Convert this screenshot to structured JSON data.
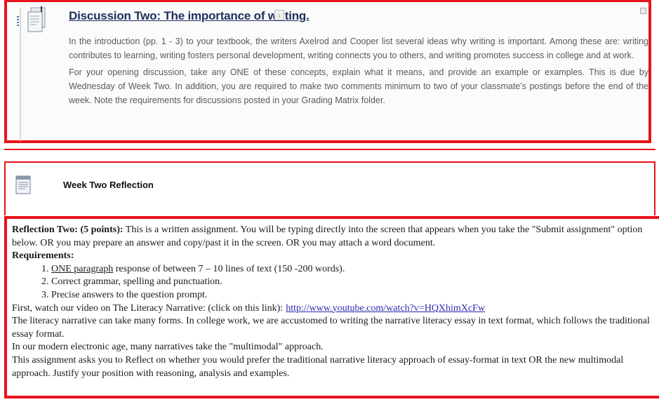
{
  "discussion": {
    "title": "Discussion Two: The importance of writing.",
    "menu_icon": "chevron-down-icon",
    "paragraph1": "In the introduction (pp. 1 - 3) to your textbook, the writers Axelrod and Cooper list several ideas why writing is important. Among these are: writing contributes to learning, writing fosters personal development, writing connects you to others, and writing promotes success in college and at work.",
    "paragraph2": "For your opening discussion, take any ONE of these concepts, explain what it means, and provide an example or examples. This is due by Wednesday of Week Two. In addition, you are required to make two comments minimum to two of your classmate's postings before the end of the week. Note the requirements for discussions posted in your Grading Matrix folder."
  },
  "week_item": {
    "title": "Week Two Reflection",
    "icon": "document-icon"
  },
  "reflection": {
    "heading": "Reflection Two: (5 points):",
    "intro": " This is a written assignment. You will be typing directly into the screen that appears when you take the \"Submit assignment\" option below. OR you may prepare an answer and copy/past it in the screen. OR you may attach a word document.",
    "requirements_label": "Requirements:",
    "req1_underlined": "ONE paragraph",
    "req1_rest": " response of between 7 – 10 lines of text (150 -200 words).",
    "req2": "Correct grammar, spelling and punctuation.",
    "req3": "Precise answers to the question prompt.",
    "video_text": "First, watch our video on The Literacy Narrative: (click on this link):",
    "video_link": "http://www.youtube.com/watch?v=HQXhimXcFw",
    "para_narrative": "The literacy narrative can take many forms. In college work, we are accustomed to writing the narrative literacy essay in text format, which follows the traditional essay format.",
    "para_modern": "In our modern electronic age, many narratives take the \"multimodal\" approach.",
    "para_assignment": "This assignment asks you to Reflect on whether you would prefer the traditional narrative literacy approach of essay-format in text OR the new multimodal approach. Justify your position with reasoning, analysis and examples."
  },
  "colors": {
    "highlight_border": "#e8121b",
    "title_blue": "#1d2f5c",
    "link_blue": "#2a2ab0"
  }
}
